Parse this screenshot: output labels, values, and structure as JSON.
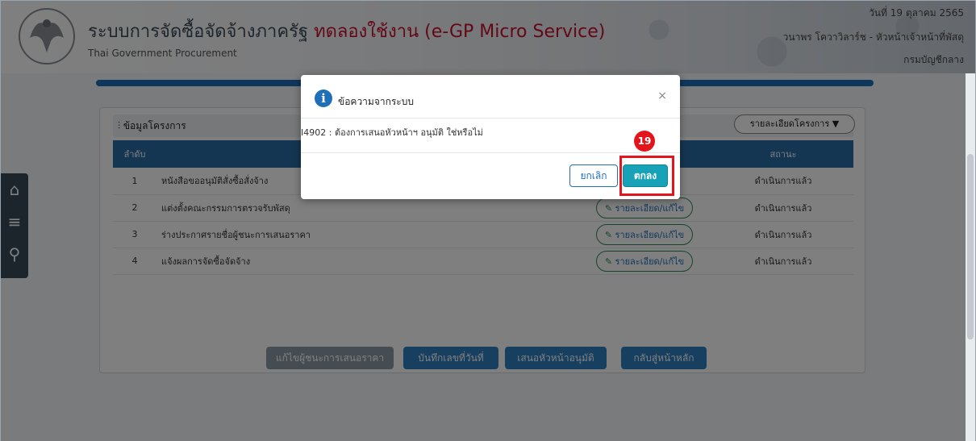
{
  "header": {
    "title_main": "ระบบการจัดซื้อจัดจ้างภาครัฐ",
    "title_test": "ทดลองใช้งาน (e-GP Micro Service)",
    "subtitle": "Thai Government Procurement",
    "date": "วันที่ 19 ตุลาคม 2565",
    "user": "วนาพร โควาวิลาร์ช - หัวหน้าเจ้าหน้าที่พัสดุ",
    "department": "กรมบัญชีกลาง"
  },
  "side_nav": {
    "icons": [
      "home-icon",
      "menu-icon",
      "search-icon"
    ]
  },
  "panel": {
    "title": "ข้อมูลโครงการ",
    "detail_dropdown": "รายละเอียดโครงการ ▼",
    "columns": [
      "ลำดับ",
      "",
      "",
      "สถานะ"
    ],
    "rows": [
      {
        "no": "1",
        "name": "หนังสือขออนุมัติสั่งซื้อสั่งจ้าง",
        "action": "",
        "status": "ดำเนินการแล้ว"
      },
      {
        "no": "2",
        "name": "แต่งตั้งคณะกรรมการตรวจรับพัสดุ",
        "action": "รายละเอียด/แก้ไข",
        "status": "ดำเนินการแล้ว"
      },
      {
        "no": "3",
        "name": "ร่างประกาศรายชื่อผู้ชนะการเสนอราคา",
        "action": "รายละเอียด/แก้ไข",
        "status": "ดำเนินการแล้ว"
      },
      {
        "no": "4",
        "name": "แจ้งผลการจัดซื้อจัดจ้าง",
        "action": "รายละเอียด/แก้ไข",
        "status": "ดำเนินการแล้ว"
      }
    ],
    "buttons": {
      "edit_winner": "แก้ไขผู้ชนะการเสนอราคา",
      "save_number_date": "บันทึกเลขที่วันที่",
      "propose_approval": "เสนอหัวหน้าอนุมัติ",
      "back_home": "กลับสู่หน้าหลัก"
    }
  },
  "modal": {
    "title": "ข้อความจากระบบ",
    "close": "×",
    "message": "I4902 : ต้องการเสนอหัวหน้าฯ อนุมัติ ใช่หรือไม่",
    "cancel": "ยกเลิก",
    "ok": "ตกลง"
  },
  "annotation": {
    "step": "19"
  },
  "colors": {
    "accent_blue": "#1e6fb8",
    "ok_teal": "#17a2b8",
    "annotation_red": "#e3141b",
    "test_red": "#c8102e"
  }
}
